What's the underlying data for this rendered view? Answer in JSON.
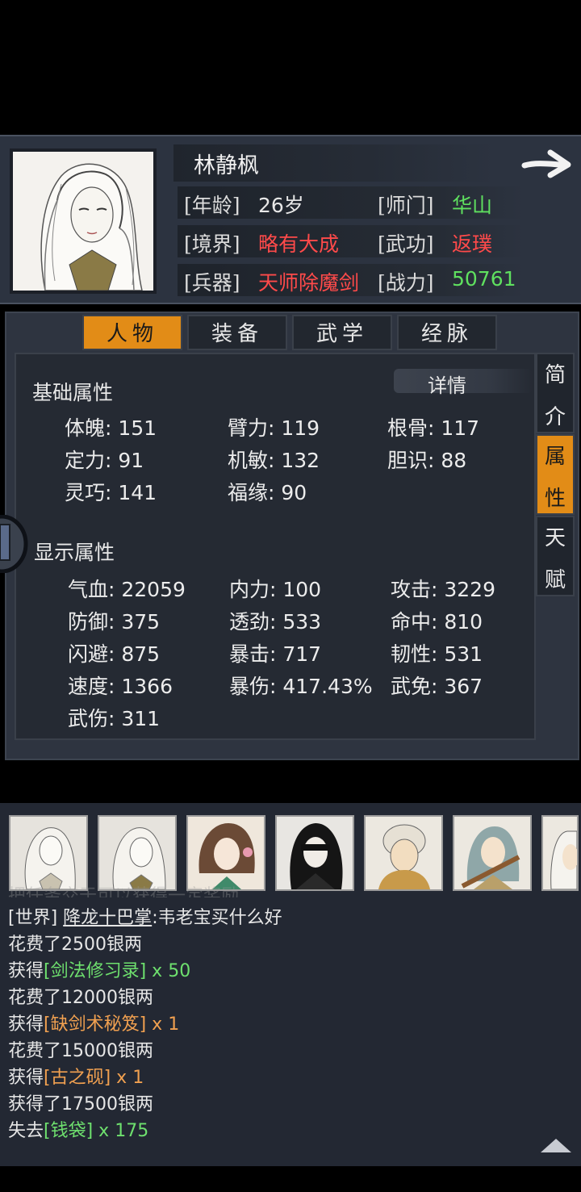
{
  "character": {
    "name": "林静枫",
    "rows": [
      {
        "label1": "[年龄]",
        "value1": "26岁",
        "color1": "#e8e8e8",
        "label2": "[师门]",
        "value2": "华山",
        "color2": "#5fe05f"
      },
      {
        "label1": "[境界]",
        "value1": "略有大成",
        "color1": "#ff4a4a",
        "label2": "[武功]",
        "value2": "返璞",
        "color2": "#ff4a4a"
      },
      {
        "label1": "[兵器]",
        "value1": "天师除魔剑",
        "color1": "#ff4a4a",
        "label2": "[战力]",
        "value2": "50761",
        "color2": "#5fe05f"
      }
    ]
  },
  "tabs": [
    "人物",
    "装备",
    "武学",
    "经脉"
  ],
  "active_tab": "人物",
  "side_tabs": [
    [
      "简",
      "介"
    ],
    [
      "属",
      "性"
    ],
    [
      "天",
      "赋"
    ]
  ],
  "detail_label": "详情",
  "basic": {
    "title": "基础属性",
    "items": [
      "体魄: 151",
      "臂力: 119",
      "根骨: 117",
      "定力: 91",
      "机敏: 132",
      "胆识: 88",
      "灵巧: 141",
      "福缘: 90"
    ]
  },
  "display": {
    "title": "显示属性",
    "items": [
      "气血: 22059",
      "内力: 100",
      "攻击: 3229",
      "防御: 375",
      "透劲: 533",
      "命中: 810",
      "闪避: 875",
      "暴击: 717",
      "韧性: 531",
      "速度: 1366",
      "暴伤: 417.43%",
      "武免: 367",
      "武伤: 311"
    ]
  },
  "log": {
    "partial_top": "把任务交于可以获得一定奖励",
    "world_tag": "[世界]",
    "world_user": "降龙十巴掌",
    "world_msg": ":韦老宝买什么好",
    "lines": [
      {
        "a": "花费了2500银两",
        "b": "",
        "c": ""
      },
      {
        "a": "获得",
        "b": "[剑法修习录]",
        "c": " x 50",
        "bc": "g"
      },
      {
        "a": "花费了12000银两",
        "b": "",
        "c": ""
      },
      {
        "a": "获得",
        "b": "[缺剑术秘笈]",
        "c": " x 1",
        "bc": "o"
      },
      {
        "a": "花费了15000银两",
        "b": "",
        "c": ""
      },
      {
        "a": "获得",
        "b": "[古之砚]",
        "c": " x 1",
        "bc": "o"
      },
      {
        "a": "获得了17500银两",
        "b": "",
        "c": ""
      },
      {
        "a": "失去",
        "b": "[钱袋]",
        "c": " x 175",
        "bc": "g"
      }
    ]
  }
}
